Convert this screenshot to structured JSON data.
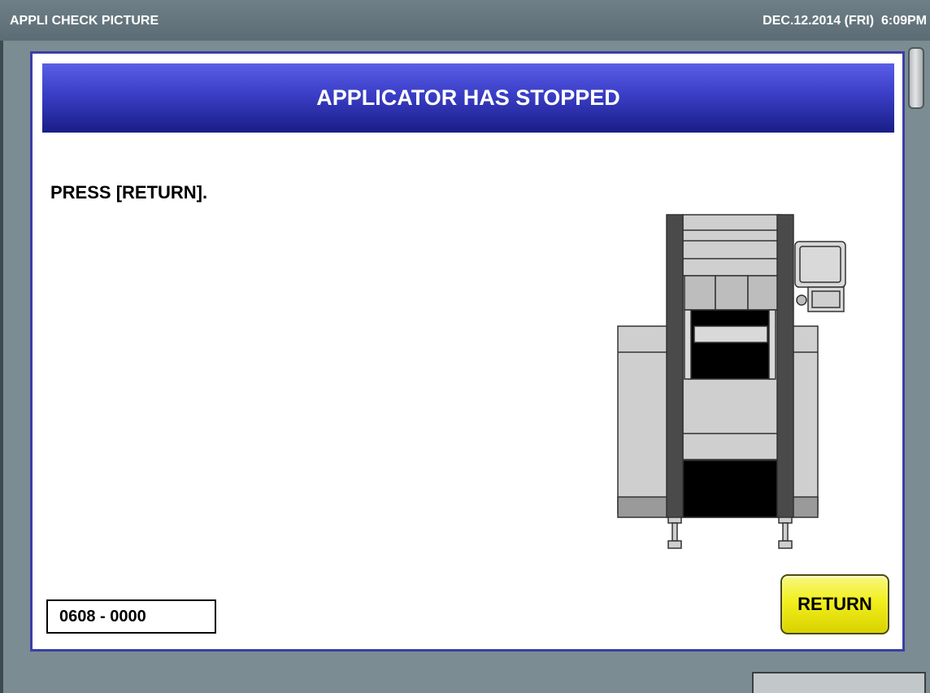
{
  "topbar": {
    "title": "APPLI CHECK PICTURE",
    "datetime": "DEC.12.2014 (FRI)  6:09PM"
  },
  "dialog": {
    "title": "APPLICATOR HAS STOPPED",
    "instruction": "PRESS [RETURN].",
    "code": "0608 - 0000",
    "return_label": "RETURN",
    "illustration": "applicator-machine-icon"
  },
  "colors": {
    "background": "#7c8c93",
    "topbar": "#66767e",
    "header_top": "#5a5ee6",
    "header_bottom": "#191d86",
    "dialog_border": "#3b3fa6",
    "return_button": "#f1ef1d"
  }
}
